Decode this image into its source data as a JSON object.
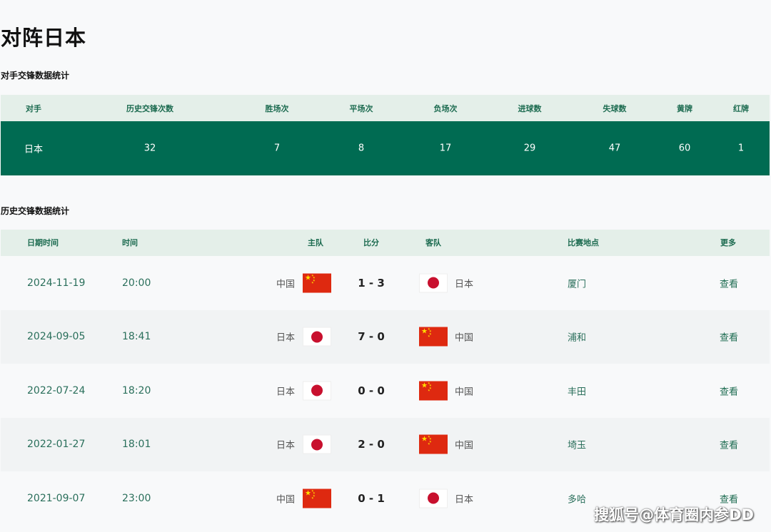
{
  "page_title": "对阵日本",
  "stats_section_title": "对手交锋数据统计",
  "stats_table": {
    "headers": [
      "对手",
      "历史交锋次数",
      "胜场次",
      "平场次",
      "负场次",
      "进球数",
      "失球数",
      "黄牌",
      "红牌"
    ],
    "row": [
      "日本",
      "32",
      "7",
      "8",
      "17",
      "29",
      "47",
      "60",
      "1"
    ]
  },
  "history_section_title": "历史交锋数据统计",
  "matches_table": {
    "headers": {
      "date": "日期时间",
      "time": "时间",
      "home": "主队",
      "score": "比分",
      "away": "客队",
      "venue": "比赛地点",
      "more": "更多"
    },
    "rows": [
      {
        "date": "2024-11-19",
        "time": "20:00",
        "home": "中国",
        "home_flag": "china-flag-icon",
        "score": "1 - 3",
        "away": "日本",
        "away_flag": "japan-flag-icon",
        "venue": "厦门",
        "more": "查看"
      },
      {
        "date": "2024-09-05",
        "time": "18:41",
        "home": "日本",
        "home_flag": "japan-flag-icon",
        "score": "7 - 0",
        "away": "中国",
        "away_flag": "china-flag-icon",
        "venue": "浦和",
        "more": "查看"
      },
      {
        "date": "2022-07-24",
        "time": "18:20",
        "home": "日本",
        "home_flag": "japan-flag-icon",
        "score": "0 - 0",
        "away": "中国",
        "away_flag": "china-flag-icon",
        "venue": "丰田",
        "more": "查看"
      },
      {
        "date": "2022-01-27",
        "time": "18:01",
        "home": "日本",
        "home_flag": "japan-flag-icon",
        "score": "2 - 0",
        "away": "中国",
        "away_flag": "china-flag-icon",
        "venue": "埼玉",
        "more": "查看"
      },
      {
        "date": "2021-09-07",
        "time": "23:00",
        "home": "中国",
        "home_flag": "china-flag-icon",
        "score": "0 - 1",
        "away": "日本",
        "away_flag": "japan-flag-icon",
        "venue": "多哈",
        "more": "查看"
      }
    ]
  },
  "watermark": "搜狐号@体育圈内参DD",
  "colors": {
    "accent": "#006b52",
    "header_bg": "#e4efe9",
    "header_text": "#1c6b50",
    "link_text": "#2a6f5b",
    "china_red": "#de2910",
    "japan_red": "#c8102e"
  }
}
